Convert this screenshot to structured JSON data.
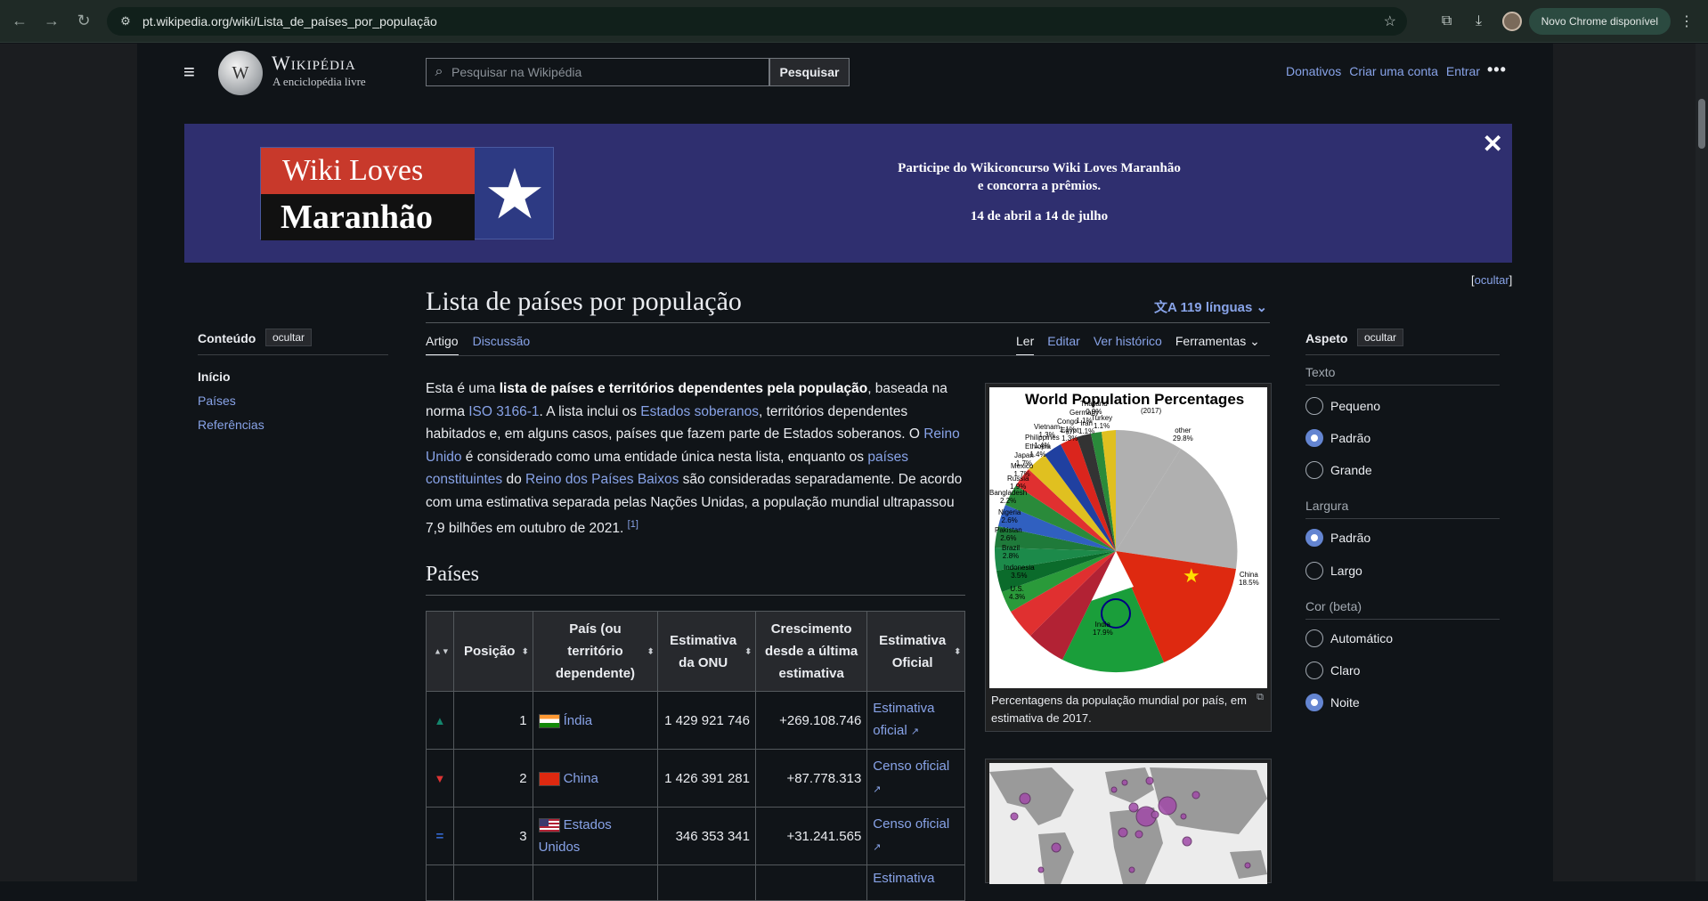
{
  "browser": {
    "url": "pt.wikipedia.org/wiki/Lista_de_países_por_população",
    "update_label": "Novo Chrome disponível"
  },
  "header": {
    "wordmark": "Wikipédia",
    "tagline": "A enciclopédia livre",
    "search_placeholder": "Pesquisar na Wikipédia",
    "search_button": "Pesquisar",
    "links": [
      "Donativos",
      "Criar uma conta",
      "Entrar"
    ]
  },
  "banner": {
    "logo_line1": "Wiki Loves",
    "logo_line2": "Maranhão",
    "text_line1": "Participe do Wikiconcurso Wiki Loves Maranhão",
    "text_line2": "e concorra a prêmios.",
    "dates": "14 de abril a 14 de julho",
    "hide_label": "ocultar"
  },
  "toc": {
    "heading": "Conteúdo",
    "hide": "ocultar",
    "items": [
      "Início",
      "Países",
      "Referências"
    ]
  },
  "article": {
    "title": "Lista de países por população",
    "languages": "119 línguas",
    "tabs_left": [
      "Artigo",
      "Discussão"
    ],
    "tabs_right": [
      "Ler",
      "Editar",
      "Ver histórico",
      "Ferramentas"
    ],
    "section": "Países",
    "intro": {
      "p1": "Esta é uma ",
      "b1": "lista de países e territórios dependentes pela população",
      "p2": ", baseada na norma ",
      "l1": "ISO 3166-1",
      "p3": ". A lista inclui os ",
      "l2": "Estados soberanos",
      "p4": ", territórios dependentes habitados e, em alguns casos, países que fazem parte de Estados soberanos. O ",
      "l3": "Reino Unido",
      "p5": " é considerado como uma entidade única nesta lista, enquanto os ",
      "l4": "países constituintes",
      "p6": " do ",
      "l5": "Reino dos Países Baixos",
      "p7": " são consideradas separadamente. De acordo com uma estimativa separada pelas Nações Unidas, a população mundial ultrapassou 7,9 bilhões em outubro de 2021. ",
      "ref": "[1]"
    }
  },
  "table": {
    "headers": [
      "Posição",
      "País (ou território dependente)",
      "Estimativa da ONU",
      "Crescimento desde a última estimativa",
      "Estimativa Oficial"
    ],
    "rows": [
      {
        "trend": "▲",
        "rank": "1",
        "country": "Índia",
        "un": "1 429 921 746",
        "growth": "+269.108.746",
        "official_a": "Estimativa",
        "official_b": "oficial"
      },
      {
        "trend": "▼",
        "rank": "2",
        "country": "China",
        "un": "1 426 391 281",
        "growth": "+87.778.313",
        "official_a": "Censo",
        "official_b": "oficial"
      },
      {
        "trend": "=",
        "rank": "3",
        "country": "Estados Unidos",
        "un": "346 353 341",
        "growth": "+31.241.565",
        "official_a": "Censo",
        "official_b": "oficial"
      },
      {
        "trend": "",
        "rank": "",
        "country": "",
        "un": "",
        "growth": "",
        "official_a": "Estimativa",
        "official_b": ""
      }
    ]
  },
  "figure1": {
    "chart_title": "World Population Percentages",
    "chart_year": "(2017)",
    "caption": "Percentagens da população mundial por país, em estimativa de 2017.",
    "labels": {
      "other": "other\n29.8%",
      "china": "China\n18.5%",
      "india": "India\n17.9%",
      "us": "U.S.\n4.3%",
      "indonesia": "Indonesia\n3.5%",
      "brazil": "Brazil\n2.8%",
      "pakistan": "Pakistan\n2.6%",
      "nigeria": "Nigeria\n2.6%",
      "bangladesh": "Bangladesh\n2.2%",
      "russia": "Russia\n1.9%",
      "mexico": "Mexico\n1.7%",
      "japan": "Japan\n1.7%",
      "ethiopia": "Ethiopia\n1.4%",
      "philippines": "Philippines\n1.4%",
      "vietnam": "Vietnam\n1.3%",
      "egypt": "Egypt\n1.3%",
      "congo": "Congo\n1.1%",
      "iran": "Iran\n1.1%",
      "germany": "Germany\n1.1%",
      "turkey": "Turkey\n1.1%",
      "thailand": "Thailand\n0.9%"
    }
  },
  "appearance": {
    "heading": "Aspeto",
    "hide": "ocultar",
    "text_label": "Texto",
    "text_options": [
      "Pequeno",
      "Padrão",
      "Grande"
    ],
    "width_label": "Largura",
    "width_options": [
      "Padrão",
      "Largo"
    ],
    "color_label": "Cor (beta)",
    "color_options": [
      "Automático",
      "Claro",
      "Noite"
    ]
  }
}
